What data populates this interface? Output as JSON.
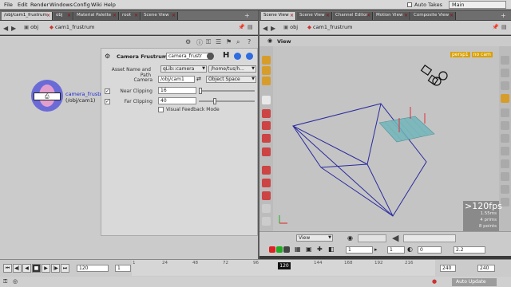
{
  "menubar": {
    "items": [
      "File",
      "Edit",
      "Render",
      "Windows",
      "Config",
      "Wiki",
      "Help"
    ],
    "auto_takes": "Auto Takes",
    "desktop": "Main"
  },
  "left_tabs": [
    "/obj/cam1_frustrum",
    "obj",
    "Material Palette",
    "root",
    "Scene View"
  ],
  "right_tabs": [
    "Scene View",
    "Scene View",
    "Channel Editor",
    "Motion View",
    "Composite View"
  ],
  "left_path": {
    "obj": "obj",
    "node": "cam1_frustrum"
  },
  "right_path": {
    "obj": "obj",
    "node": "cam1_frustrum"
  },
  "node": {
    "name": "camera_frustrum",
    "path": "(/obj/cam1)"
  },
  "params": {
    "title": "Camera Frustrum",
    "name_value": "camera_frustr",
    "asset_label": "Asset Name and Path",
    "asset_name": "qLib::camera",
    "asset_path": "/home/tus/h...",
    "camera_label": "Camera",
    "camera_value": "/obj/cam1",
    "space_value": "Object Space",
    "near_label": "Near Clipping",
    "near_value": "16",
    "far_label": "Far Clipping",
    "far_value": "40",
    "visual_label": "Visual Feedback Mode"
  },
  "viewport": {
    "title": "View",
    "persp": "persp1",
    "cam": "no cam",
    "fps": ">120fps",
    "ms": "1.55ms",
    "prims": "4 prims",
    "points": "8 points",
    "view_menu": "View",
    "bottom_value1": "1",
    "bottom_value2": "1",
    "bottom_value3": "0",
    "bottom_value4": "2.2"
  },
  "timeline": {
    "frame": "120",
    "start": "1",
    "playhead": "120",
    "ticks": [
      "1",
      "24",
      "48",
      "72",
      "96",
      "144",
      "168",
      "192",
      "216"
    ],
    "end": "240",
    "end2": "240",
    "auto_update": "Auto Update"
  },
  "colors": {
    "frustum": "#2a2aa0",
    "plane": "#5aa0a8",
    "accent": "#d9a100"
  }
}
